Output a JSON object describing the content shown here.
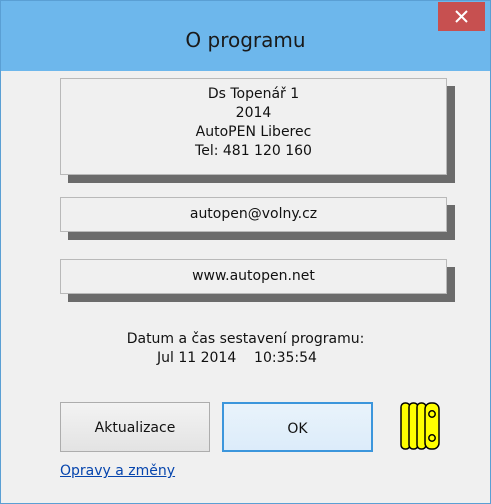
{
  "window": {
    "title": "O programu",
    "close_icon": "close-icon"
  },
  "info": {
    "lines": [
      "Ds Topenář 1",
      "2014",
      "AutoPEN Liberec",
      "Tel: 481 120 160"
    ]
  },
  "links": {
    "email": "autopen@volny.cz",
    "web": "www.autopen.net"
  },
  "build": {
    "label": "Datum a čas sestavení programu:",
    "value": "Jul 11 2014    10:35:54"
  },
  "buttons": {
    "update": "Aktualizace",
    "ok": "OK"
  },
  "footer": {
    "changes_link": "Opravy a změny"
  },
  "colors": {
    "titlebar": "#6db7ec",
    "close": "#c75050",
    "logo_fill": "#ffff00",
    "link": "#0645ad"
  }
}
